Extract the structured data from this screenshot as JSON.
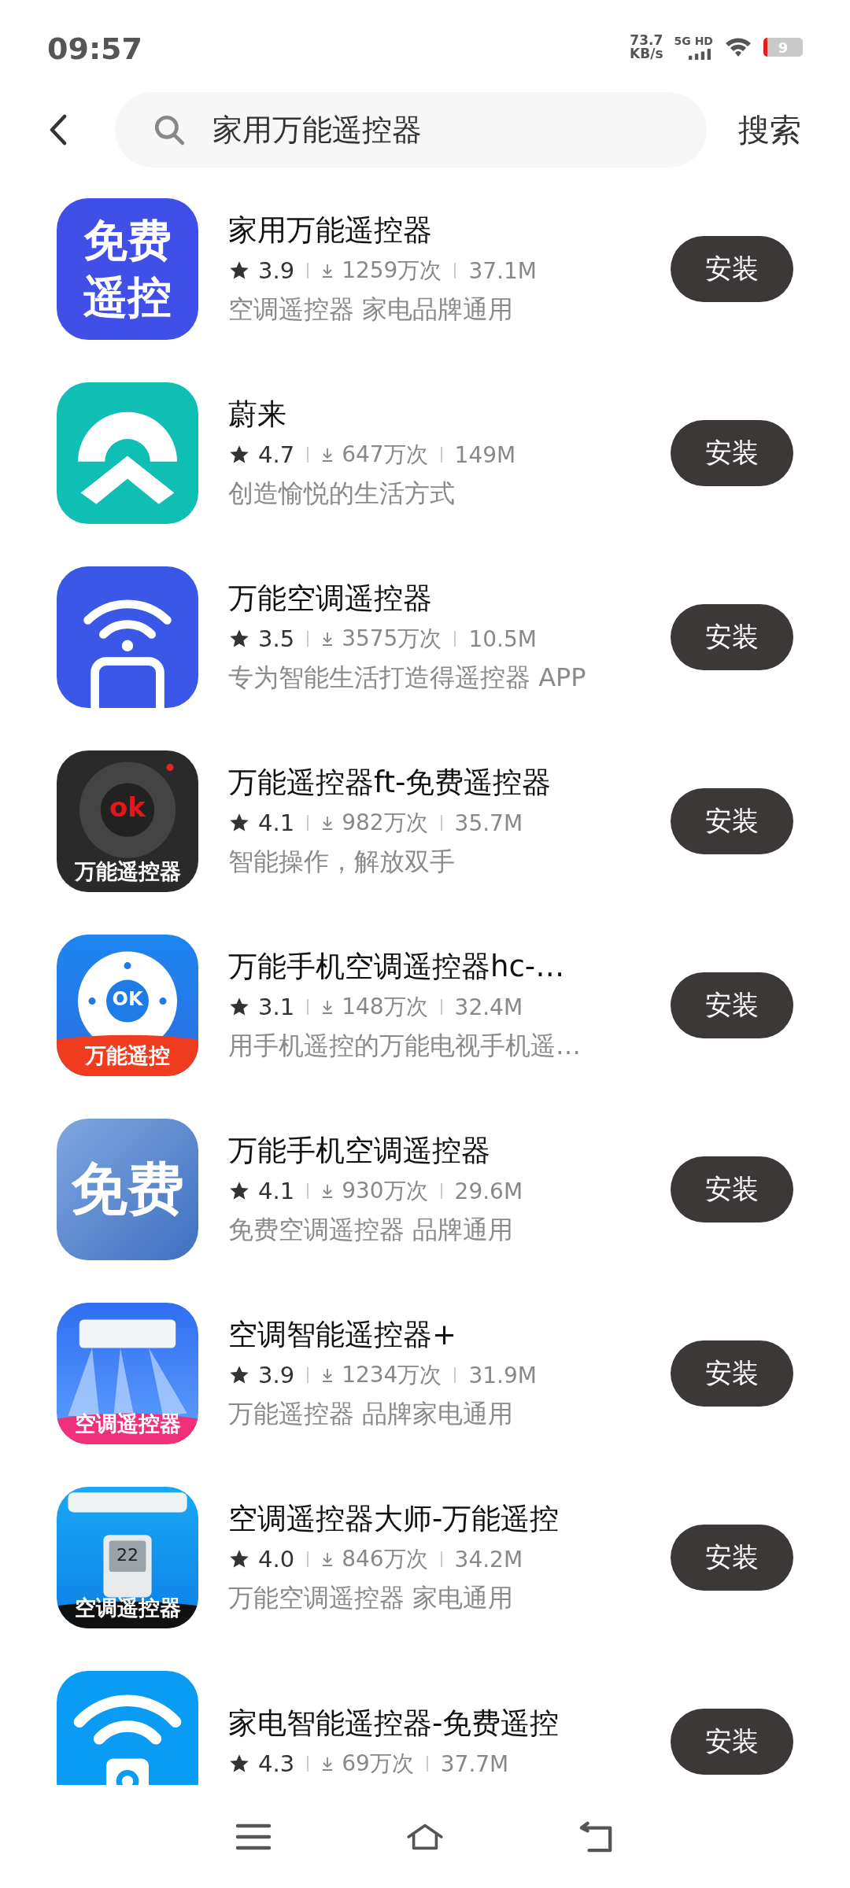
{
  "status_bar": {
    "time": "09:57",
    "net_speed": "73.7",
    "net_unit": "KB/s",
    "network": "5G HD",
    "battery": "9"
  },
  "search": {
    "value": "家用万能遥控器",
    "button": "搜索"
  },
  "apps": [
    {
      "name": "家用万能遥控器",
      "rating": "3.9",
      "downloads": "1259万次",
      "size": "37.1M",
      "description": "空调遥控器 家电品牌通用",
      "icon": {
        "kind": "text_badge",
        "texts": [
          "免费",
          "遥控"
        ]
      },
      "button": "安装"
    },
    {
      "name": "蔚来",
      "rating": "4.7",
      "downloads": "647万次",
      "size": "149M",
      "description": "创造愉悦的生活方式",
      "icon": {
        "kind": "arch"
      },
      "button": "安装"
    },
    {
      "name": "万能空调遥控器",
      "rating": "3.5",
      "downloads": "3575万次",
      "size": "10.5M",
      "description": "专为智能生活打造得遥控器 APP",
      "icon": {
        "kind": "wifi_phone"
      },
      "button": "安装"
    },
    {
      "name": "万能遥控器ft-免费遥控器",
      "rating": "4.1",
      "downloads": "982万次",
      "size": "35.7M",
      "description": "智能操作，解放双手",
      "icon": {
        "kind": "dark_remote",
        "texts": [
          "ok",
          "万能遥控器"
        ]
      },
      "button": "安装"
    },
    {
      "name": "万能手机空调遥控器hc-…",
      "rating": "3.1",
      "downloads": "148万次",
      "size": "32.4M",
      "description": "用手机遥控的万能电视手机遥…",
      "icon": {
        "kind": "ok_remote",
        "texts": [
          "OK",
          "万能遥控"
        ]
      },
      "button": "安装"
    },
    {
      "name": "万能手机空调遥控器",
      "rating": "4.1",
      "downloads": "930万次",
      "size": "29.6M",
      "description": "免费空调遥控器 品牌通用",
      "icon": {
        "kind": "calligraphy",
        "texts": [
          "免费"
        ]
      },
      "button": "安装"
    },
    {
      "name": "空调智能遥控器+",
      "rating": "3.9",
      "downloads": "1234万次",
      "size": "31.9M",
      "description": "万能遥控器 品牌家电通用",
      "icon": {
        "kind": "ac_unit",
        "texts": [
          "空调遥控器"
        ]
      },
      "button": "安装"
    },
    {
      "name": "空调遥控器大师-万能遥控",
      "rating": "4.0",
      "downloads": "846万次",
      "size": "34.2M",
      "description": "万能空调遥控器 家电通用",
      "icon": {
        "kind": "ac_remote",
        "texts": [
          "22",
          "空调遥控器"
        ]
      },
      "button": "安装"
    },
    {
      "name": "家电智能遥控器-免费遥控",
      "rating": "4.3",
      "downloads": "69万次",
      "size": "37.7M",
      "icon": {
        "kind": "wifi_remote"
      },
      "button": "安装"
    }
  ]
}
